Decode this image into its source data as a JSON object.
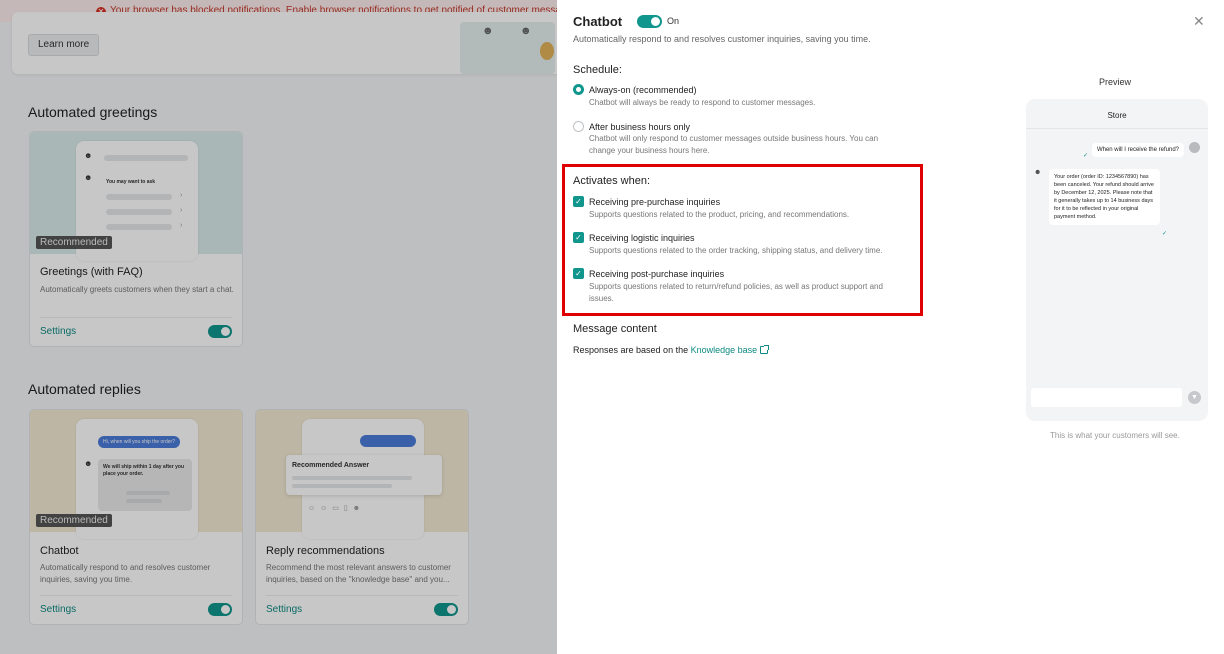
{
  "background": {
    "notification": "Your browser has blocked notifications. Enable browser notifications to get notified of customer messag",
    "learn_more": "Learn more",
    "automated_greetings_title": "Automated greetings",
    "automated_replies_title": "Automated replies",
    "greetings_card": {
      "badge": "Recommended",
      "title": "Greetings (with FAQ)",
      "desc": "Automatically greets customers when they start a chat.",
      "settings": "Settings",
      "illus_text": "You may want to ask"
    },
    "chatbot_card": {
      "badge": "Recommended",
      "title": "Chatbot",
      "desc": "Automatically respond to and resolves customer inquiries, saving you time.",
      "settings": "Settings",
      "illus_question": "Hi, when will you ship the order?",
      "illus_answer": "We will ship within 1 day after you place your order."
    },
    "reply_card": {
      "title": "Reply recommendations",
      "desc": "Recommend the most relevant answers to customer inquiries, based on the \"knowledge base\" and you...",
      "settings": "Settings",
      "illus_text": "Recommended Answer"
    }
  },
  "drawer": {
    "title": "Chatbot",
    "toggle_state": "On",
    "subtitle": "Automatically respond to and resolves customer inquiries, saving you time.",
    "schedule_title": "Schedule:",
    "schedule_options": [
      {
        "label": "Always-on (recommended)",
        "desc": "Chatbot will always be ready to respond to customer messages."
      },
      {
        "label": "After business hours only",
        "desc": "Chatbot will only respond to customer messages outside business hours. You can change your business hours here."
      }
    ],
    "activates_title": "Activates when:",
    "activates_options": [
      {
        "label": "Receiving pre-purchase inquiries",
        "desc": "Supports questions related to the product, pricing, and recommendations."
      },
      {
        "label": "Receiving logistic inquiries",
        "desc": "Supports questions related to the order tracking, shipping status, and delivery time."
      },
      {
        "label": "Receiving post-purchase inquiries",
        "desc": "Supports questions related to return/refund policies, as well as product support and issues."
      }
    ],
    "message_content_title": "Message content",
    "responses_prefix": "Responses are based on the",
    "knowledge_base_link": "Knowledge base"
  },
  "preview": {
    "label": "Preview",
    "store": "Store",
    "user_message": "When will I receive the refund?",
    "bot_message": "Your order (order ID: 1234567890) has been canceled. Your refund should arrive by December 12, 2025. Please note that it generally takes up to 14 business days for it to be reflected in your original payment method.",
    "footer": "This is what your customers will see."
  },
  "colors": {
    "accent": "#10968c",
    "highlight": "#e00000"
  }
}
